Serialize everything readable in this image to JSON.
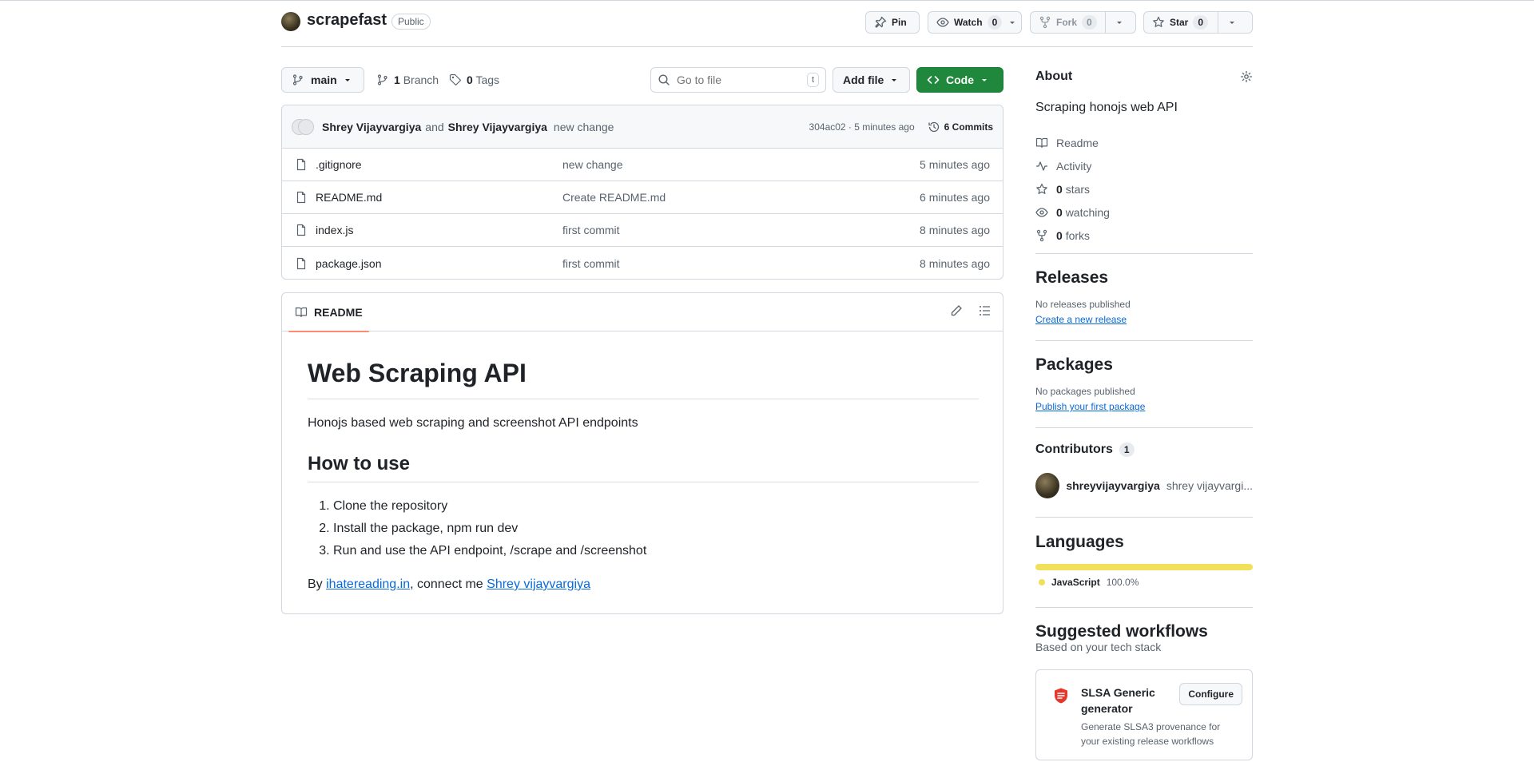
{
  "repo": {
    "name": "scrapefast",
    "visibility": "Public"
  },
  "header_actions": {
    "pin_label": "Pin",
    "watch_label": "Watch",
    "watch_count": "0",
    "fork_label": "Fork",
    "fork_count": "0",
    "star_label": "Star",
    "star_count": "0"
  },
  "toolbar": {
    "branch": "main",
    "branches_count": "1",
    "branches_label": "Branch",
    "tags_count": "0",
    "tags_label": "Tags",
    "search_placeholder": "Go to file",
    "search_shortcut": "t",
    "add_file_label": "Add file",
    "code_label": "Code"
  },
  "latest_commit": {
    "author1": "Shrey Vijayvargiya",
    "and_text": "and",
    "author2": "Shrey Vijayvargiya",
    "message": "new change",
    "meta": "304ac02 · 5 minutes ago",
    "commits_label": "6 Commits"
  },
  "files": [
    {
      "name": ".gitignore",
      "message": "new change",
      "age": "5 minutes ago"
    },
    {
      "name": "README.md",
      "message": "Create README.md",
      "age": "6 minutes ago"
    },
    {
      "name": "index.js",
      "message": "first commit",
      "age": "8 minutes ago"
    },
    {
      "name": "package.json",
      "message": "first commit",
      "age": "8 minutes ago"
    }
  ],
  "readme": {
    "tab_label": "README",
    "h1": "Web Scraping API",
    "intro": "Honojs based web scraping and screenshot API endpoints",
    "h2": "How to use",
    "steps": [
      "Clone the repository",
      "Install the package, npm run dev",
      "Run and use the API endpoint, /scrape and /screenshot"
    ],
    "by_prefix": "By",
    "link1": "ihatereading.in",
    "connect_text": ", connect me",
    "link2": "Shrey vijayvargiya"
  },
  "about": {
    "title": "About",
    "description": "Scraping honojs web API",
    "readme_label": "Readme",
    "activity_label": "Activity",
    "stars_count": "0",
    "stars_label": "stars",
    "watching_count": "0",
    "watching_label": "watching",
    "forks_count": "0",
    "forks_label": "forks"
  },
  "releases": {
    "title": "Releases",
    "empty": "No releases published",
    "link": "Create a new release"
  },
  "packages": {
    "title": "Packages",
    "empty": "No packages published",
    "link": "Publish your first package"
  },
  "contributors": {
    "title": "Contributors",
    "count": "1",
    "login": "shreyvijayvargiya",
    "name": "shrey vijayvargi..."
  },
  "languages": {
    "title": "Languages",
    "items": [
      {
        "name": "JavaScript",
        "percent": "100.0%",
        "color": "#f1e05a",
        "share": 1.0
      }
    ]
  },
  "workflows": {
    "title": "Suggested workflows",
    "subtitle": "Based on your tech stack",
    "card_title": "SLSA Generic generator",
    "card_desc": "Generate SLSA3 provenance for your existing release workflows",
    "configure_label": "Configure"
  },
  "colors": {
    "accent_green": "#1f883d",
    "link": "#0969da",
    "tab_underline": "#fd8c73"
  }
}
